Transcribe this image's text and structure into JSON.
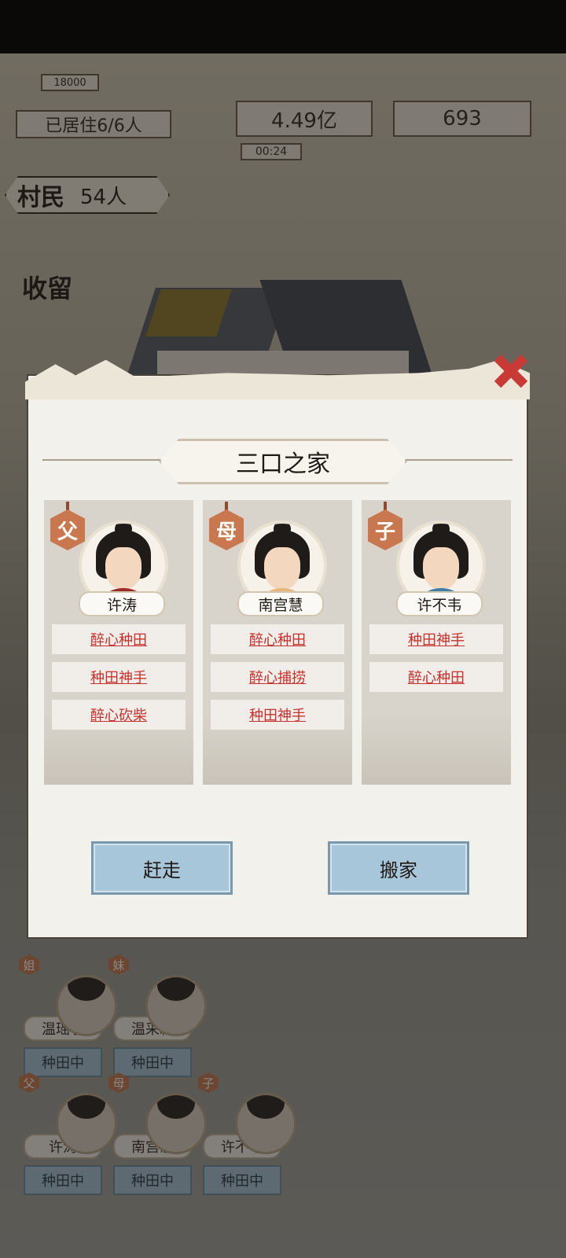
{
  "background": {
    "residence_label": "已居住6/6人",
    "coins": "4.49亿",
    "gold": "693",
    "timer": "00:24",
    "small_value": "18000",
    "village_label": "村民",
    "village_count": "54人",
    "shouliu_label": "收留",
    "list": {
      "row1": [
        {
          "role": "姐",
          "name": "温瑶宁",
          "status": "种田中"
        },
        {
          "role": "妹",
          "name": "温采颖",
          "status": "种田中"
        }
      ],
      "row2": [
        {
          "role": "父",
          "name": "许涛",
          "status": "种田中"
        },
        {
          "role": "母",
          "name": "南宫慧",
          "status": "种田中"
        },
        {
          "role": "子",
          "name": "许不韦",
          "status": "种田中"
        }
      ]
    }
  },
  "dialog": {
    "title": "三口之家",
    "members": [
      {
        "role": "父",
        "name": "许涛",
        "traits": [
          "醉心种田",
          "种田神手",
          "醉心砍柴"
        ],
        "outfit_color": "#9a2b25"
      },
      {
        "role": "母",
        "name": "南宫慧",
        "traits": [
          "醉心种田",
          "醉心捕捞",
          "种田神手"
        ],
        "outfit_color": "#e8b67a"
      },
      {
        "role": "子",
        "name": "许不韦",
        "traits": [
          "种田神手",
          "醉心种田"
        ],
        "outfit_color": "#3f7fa6"
      }
    ],
    "buttons": {
      "evict": "赶走",
      "move": "搬家"
    }
  },
  "colors": {
    "trait_red": "#c8302d",
    "button_blue": "#a8c6da",
    "role_badge": "#c9774e"
  }
}
